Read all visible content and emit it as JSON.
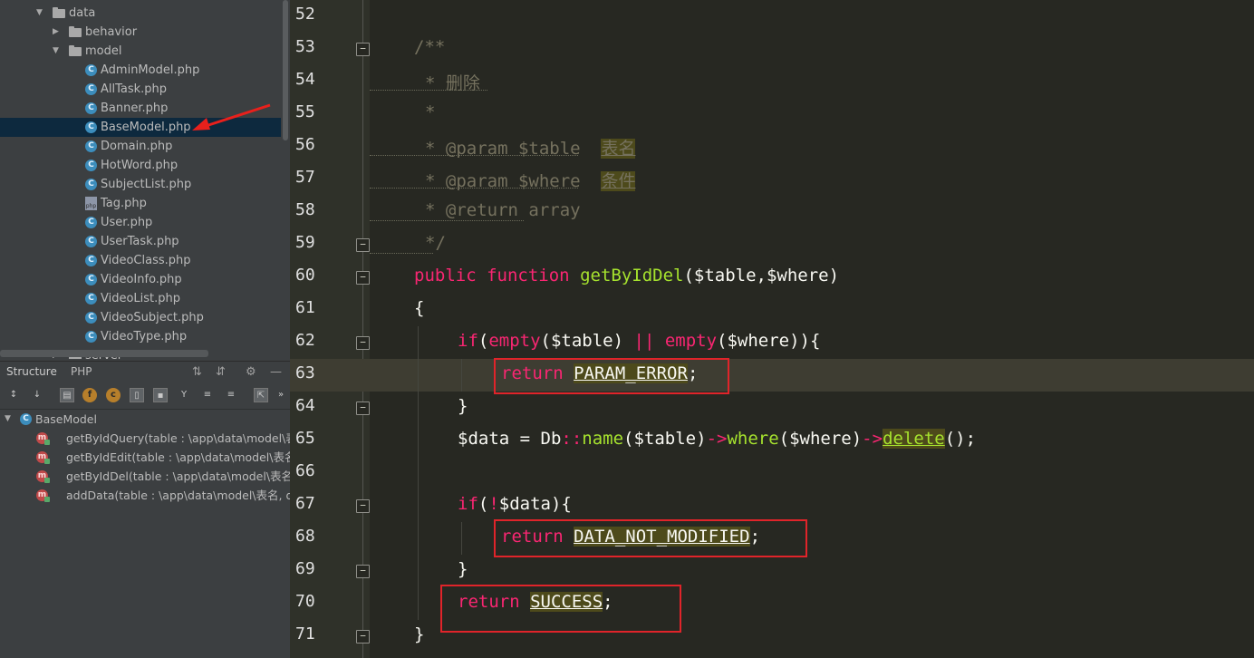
{
  "project_tree": {
    "items": [
      {
        "label": "data",
        "kind": "folder",
        "expanded": true
      },
      {
        "label": "behavior",
        "kind": "folder",
        "expanded": false
      },
      {
        "label": "model",
        "kind": "folder",
        "expanded": true
      },
      {
        "label": "AdminModel.php",
        "kind": "class"
      },
      {
        "label": "AllTask.php",
        "kind": "class"
      },
      {
        "label": "Banner.php",
        "kind": "class"
      },
      {
        "label": "BaseModel.php",
        "kind": "class",
        "selected": true
      },
      {
        "label": "Domain.php",
        "kind": "class"
      },
      {
        "label": "HotWord.php",
        "kind": "class"
      },
      {
        "label": "SubjectList.php",
        "kind": "class"
      },
      {
        "label": "Tag.php",
        "kind": "php"
      },
      {
        "label": "User.php",
        "kind": "class"
      },
      {
        "label": "UserTask.php",
        "kind": "class"
      },
      {
        "label": "VideoClass.php",
        "kind": "class"
      },
      {
        "label": "VideoInfo.php",
        "kind": "class"
      },
      {
        "label": "VideoList.php",
        "kind": "class"
      },
      {
        "label": "VideoSubject.php",
        "kind": "class"
      },
      {
        "label": "VideoType.php",
        "kind": "class"
      },
      {
        "label": "server",
        "kind": "folder",
        "expanded": false
      }
    ]
  },
  "panel_tabs": {
    "structure": "Structure",
    "php": "PHP"
  },
  "toolbar": {
    "icons": [
      "sort-visibility-icon",
      "sort-alpha-icon",
      "show-inherited-icon",
      "show-fields-icon",
      "show-constants-icon",
      "show-includes-icon",
      "show-private-icon",
      "filter-icon",
      "expand-all-icon",
      "collapse-all-icon",
      "autoscroll-icon"
    ],
    "more": "»"
  },
  "structure": {
    "root": "BaseModel",
    "methods": [
      "getByIdQuery(table : \\app\\data\\model\\表名",
      "getByIdEdit(table : \\app\\data\\model\\表名,",
      "getByIdDel(table : \\app\\data\\model\\表名, \\",
      "addData(table : \\app\\data\\model\\表名, da"
    ]
  },
  "editor": {
    "line_numbers": [
      "52",
      "53",
      "54",
      "55",
      "56",
      "57",
      "58",
      "59",
      "60",
      "61",
      "62",
      "63",
      "64",
      "65",
      "66",
      "67",
      "68",
      "69",
      "70",
      "71"
    ],
    "current_line": "63",
    "code": {
      "l53": "/**",
      "l54": "* 删除",
      "l55": "*",
      "l56_a": "* @param $table  ",
      "l56_b": "表名",
      "l57_a": "* @param $where  ",
      "l57_b": "条件",
      "l58": "* @return array",
      "l59": "*/",
      "l60_kw1": "public",
      "l60_kw2": "function",
      "l60_fn": "getByIdDel",
      "l60_args": "($table,$where)",
      "l61": "{",
      "l62_if": "if",
      "l62_p1": "(",
      "l62_e1": "empty",
      "l62_a1": "($table) ",
      "l62_or": "||",
      "l62_sp": " ",
      "l62_e2": "empty",
      "l62_a2": "($where)){",
      "l63_ret": "return",
      "l63_const": "PARAM_ERROR",
      "l63_semi": ";",
      "l64": "}",
      "l65_a": "$data = Db",
      "l65_dc": "::",
      "l65_name": "name",
      "l65_b": "($table)",
      "l65_ar1": "->",
      "l65_where": "where",
      "l65_c": "($where)",
      "l65_ar2": "->",
      "l65_del": "delete",
      "l65_d": "();",
      "l67_if": "if",
      "l67_p": "(",
      "l67_not": "!",
      "l67_rest": "$data){",
      "l68_ret": "return",
      "l68_const": "DATA_NOT_MODIFIED",
      "l68_semi": ";",
      "l69": "}",
      "l70_ret": "return",
      "l70_const": "SUCCESS",
      "l70_semi": ";",
      "l71": "}"
    }
  },
  "colors": {
    "editor_bg": "#272822",
    "keyword": "#f92672",
    "function": "#a6e22e",
    "comment": "#75715e",
    "annotation_box": "#e0242a"
  }
}
